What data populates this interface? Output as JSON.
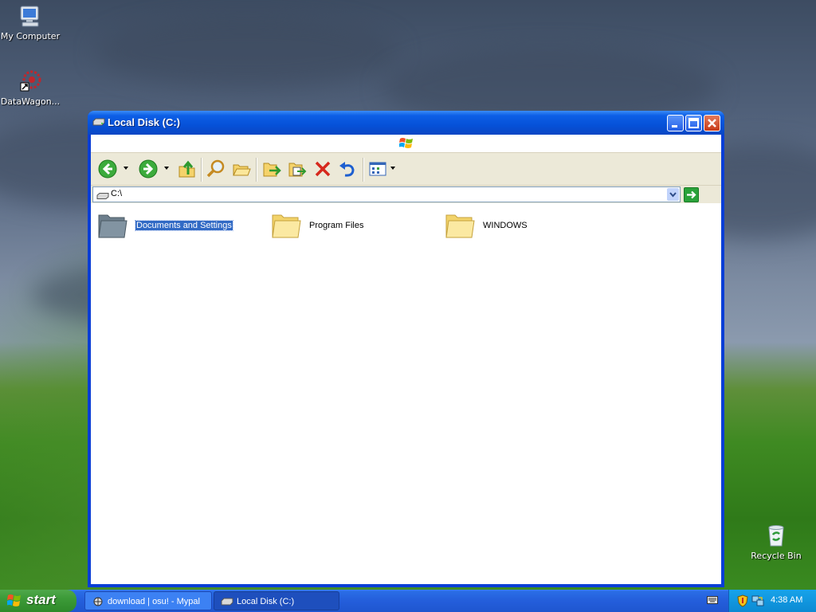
{
  "desktop": {
    "icons": [
      {
        "label": "My Computer",
        "icon": "my-computer-icon"
      },
      {
        "label": "DataWagon...",
        "icon": "datawagon-shortcut-icon"
      },
      {
        "label": "Recycle Bin",
        "icon": "recycle-bin-icon"
      }
    ]
  },
  "window": {
    "title": "Local Disk (C:)",
    "address": "C:\\",
    "toolbar": [
      "back-icon",
      "forward-icon",
      "up-folder-icon",
      "search-icon",
      "folders-icon",
      "move-to-icon",
      "copy-to-icon",
      "delete-icon",
      "undo-icon",
      "views-icon"
    ],
    "items": [
      {
        "name": "Documents and Settings",
        "selected": true
      },
      {
        "name": "Program Files",
        "selected": false
      },
      {
        "name": "WINDOWS",
        "selected": false
      }
    ]
  },
  "taskbar": {
    "start_label": "start",
    "tasks": [
      {
        "label": "download | osu! - Mypal"
      },
      {
        "label": "Local Disk (C:)"
      }
    ],
    "clock": "4:38 AM"
  }
}
